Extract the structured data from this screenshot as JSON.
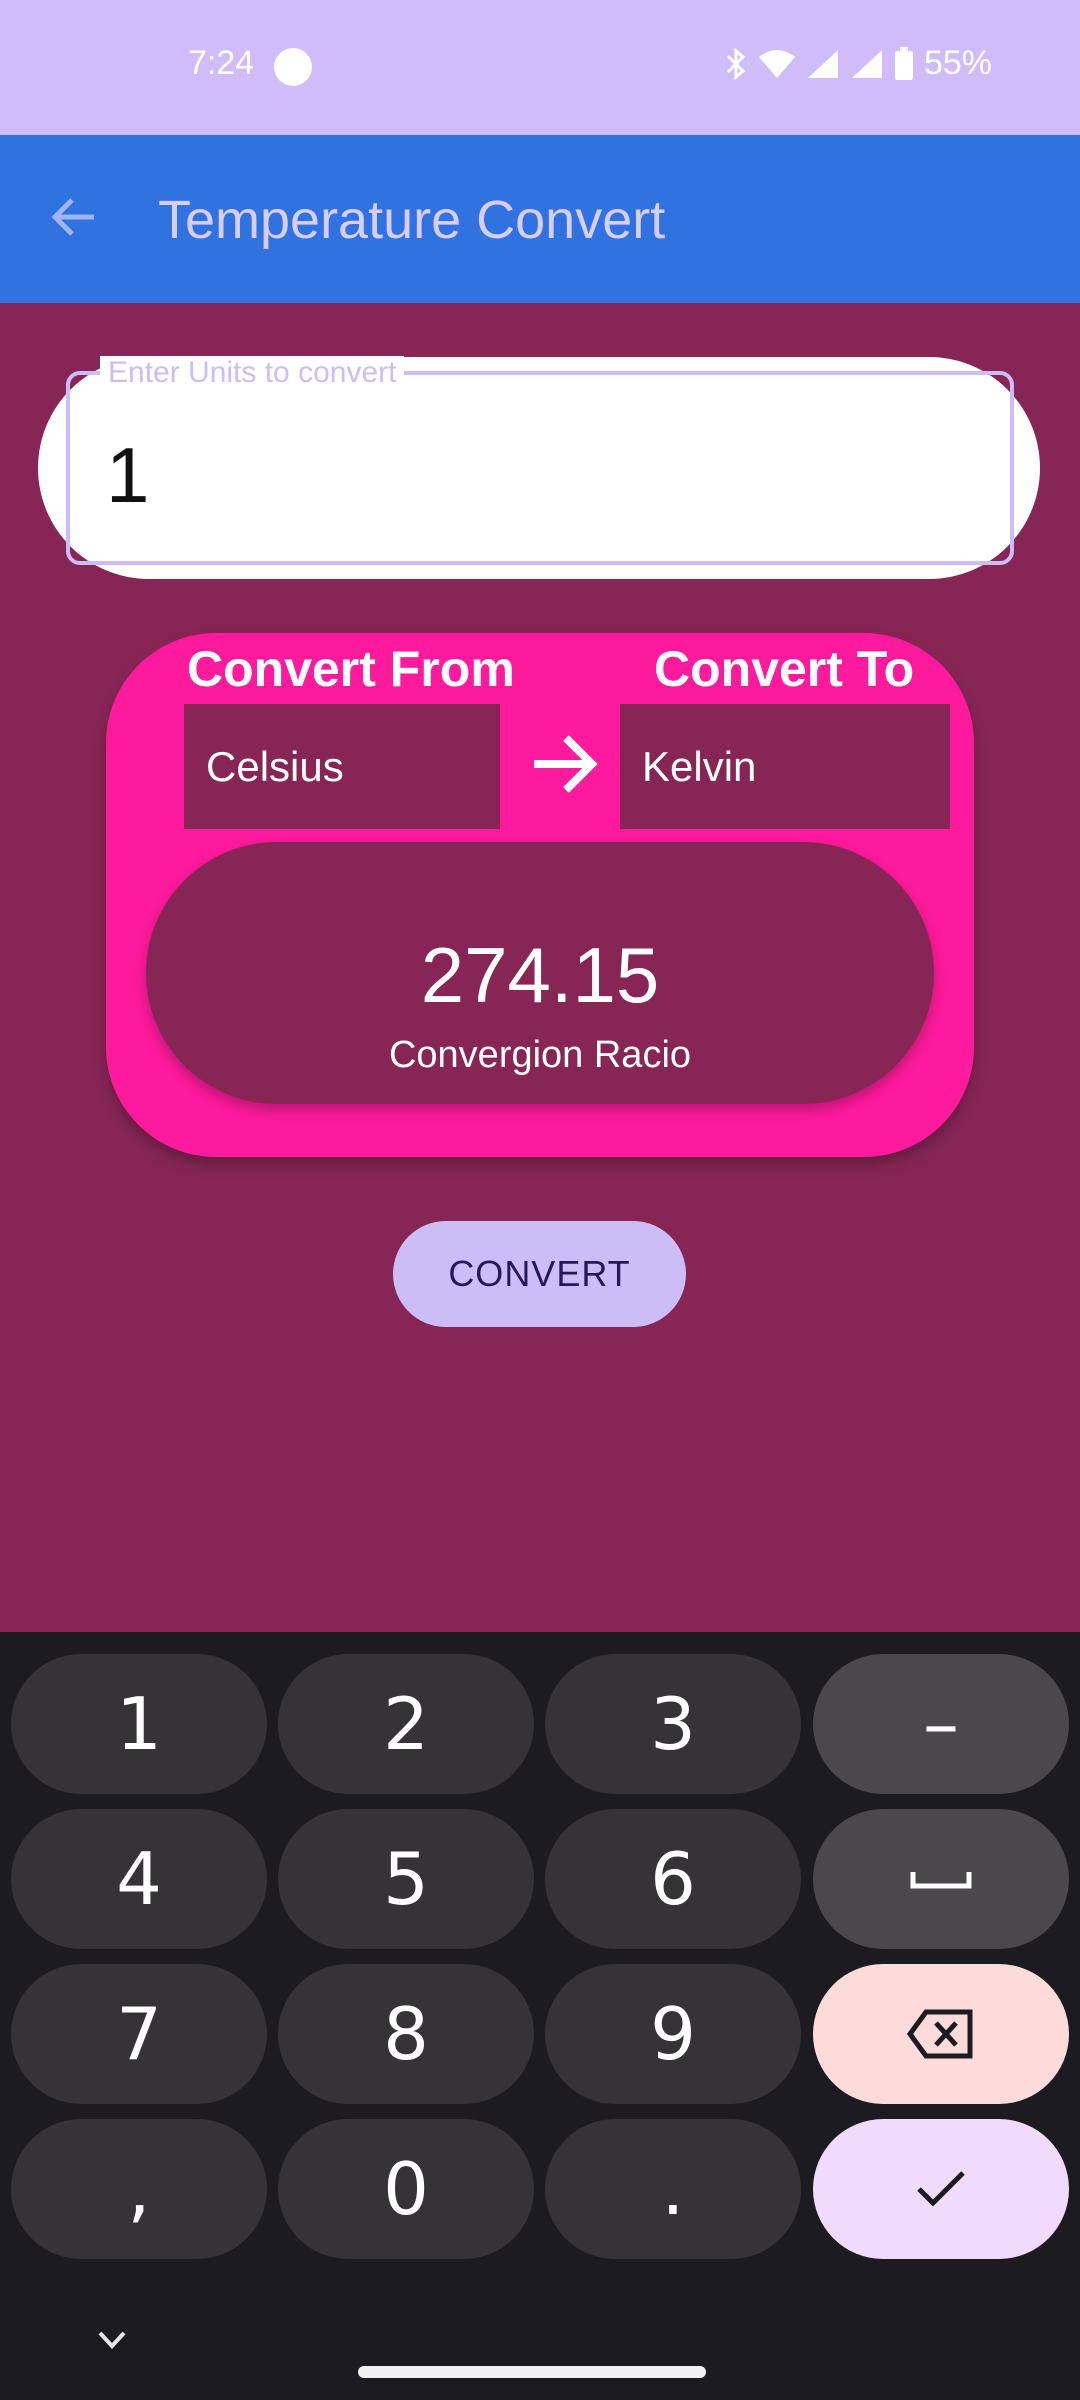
{
  "status_bar": {
    "time": "7:24",
    "battery": "55%"
  },
  "app_bar": {
    "title": "Temperature Convert"
  },
  "input": {
    "label": "Enter Units to convert",
    "value": "1"
  },
  "converter": {
    "from_header": "Convert From",
    "to_header": "Convert To",
    "from_unit": "Celsius",
    "to_unit": "Kelvin",
    "result_value": "274.15",
    "result_label": "Convergion Racio"
  },
  "convert_button": {
    "label": "CONVERT"
  },
  "keyboard": {
    "keys": [
      "1",
      "2",
      "3",
      "–",
      "4",
      "5",
      "6",
      "7",
      "8",
      "9",
      ",",
      "0",
      "."
    ]
  },
  "colors": {
    "background": "#872655",
    "app_bar": "#2f72e0",
    "status_bar": "#cfbcf9",
    "card_accent": "#fe1a9c",
    "button": "#cdbdf7",
    "keyboard_bg": "#1c1b1f"
  },
  "icons": [
    "back-arrow-icon",
    "right-arrow-icon",
    "space-icon",
    "backspace-icon",
    "checkmark-icon",
    "chevron-down-icon",
    "bluetooth-icon",
    "wifi-icon",
    "signal-icon",
    "battery-icon"
  ]
}
